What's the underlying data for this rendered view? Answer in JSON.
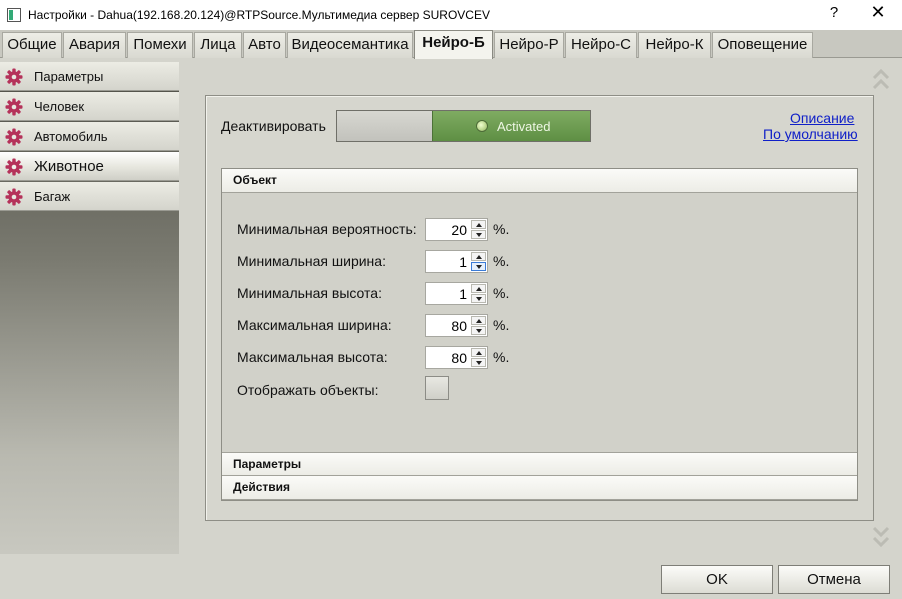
{
  "window": {
    "title": "Настройки - Dahua(192.168.20.124)@RTPSource.Мультимедиа сервер SUROVCEV",
    "help": "?",
    "close": "✕"
  },
  "tabs": [
    {
      "label": "Общие"
    },
    {
      "label": "Авария"
    },
    {
      "label": "Помехи"
    },
    {
      "label": "Лица"
    },
    {
      "label": "Авто"
    },
    {
      "label": "Видеосемантика"
    },
    {
      "label": "Нейро-Б"
    },
    {
      "label": "Нейро-Р"
    },
    {
      "label": "Нейро-С"
    },
    {
      "label": "Нейро-К"
    },
    {
      "label": "Оповещение"
    }
  ],
  "active_tab": "Нейро-Б",
  "sidebar": {
    "items": [
      {
        "label": "Параметры",
        "icon": "gear-icon"
      },
      {
        "label": "Человек",
        "icon": "gear-icon"
      },
      {
        "label": "Автомобиль",
        "icon": "gear-icon"
      },
      {
        "label": "Животное",
        "icon": "gear-icon"
      },
      {
        "label": "Багаж",
        "icon": "gear-icon"
      }
    ],
    "active": "Животное"
  },
  "panel": {
    "deactivate_label": "Деактивировать",
    "toggle_state_text": "Activated",
    "link_description": "Описание",
    "link_default": "По умолчанию",
    "object_group": {
      "title": "Объект",
      "fields": [
        {
          "label": "Минимальная вероятность:",
          "value": "20",
          "unit": "%."
        },
        {
          "label": "Минимальная ширина:",
          "value": "1",
          "unit": "%."
        },
        {
          "label": "Минимальная высота:",
          "value": "1",
          "unit": "%."
        },
        {
          "label": "Максимальная ширина:",
          "value": "80",
          "unit": "%."
        },
        {
          "label": "Максимальная высота:",
          "value": "80",
          "unit": "%."
        }
      ],
      "show_objects_label": "Отображать объекты:"
    },
    "params_group_title": "Параметры",
    "actions_group_title": "Действия"
  },
  "footer": {
    "ok": "OK",
    "cancel": "Отмена"
  },
  "colors": {
    "gear_icon": "#b5325a",
    "toggle_on": "#6c9a50",
    "link": "#1020c8"
  }
}
